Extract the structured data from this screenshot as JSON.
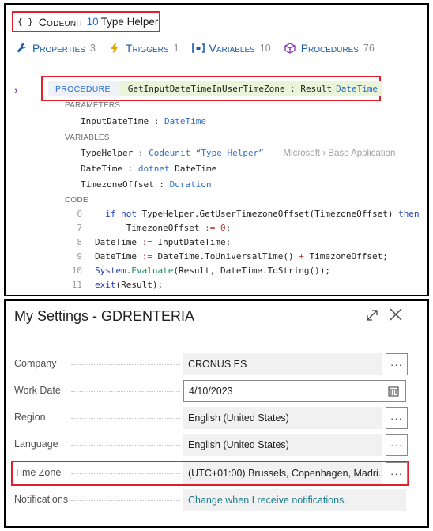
{
  "codeunit": {
    "kind": "Codeunit",
    "number": "10",
    "name": "Type Helper"
  },
  "tabs": [
    {
      "label": "Properties",
      "count": "3",
      "icon": "wrench-icon"
    },
    {
      "label": "Triggers",
      "count": "1",
      "icon": "lightning-icon"
    },
    {
      "label": "Variables",
      "count": "10",
      "icon": "variable-icon"
    },
    {
      "label": "Procedures",
      "count": "76",
      "icon": "cube-icon"
    }
  ],
  "procedure": {
    "tag": "PROCEDURE",
    "signature": "GetInputDateTimeInUserTimeZone : Result",
    "return_type": "DateTime"
  },
  "sections": {
    "parameters": "PARAMETERS",
    "variables": "VARIABLES",
    "code": "CODE"
  },
  "parameters": [
    {
      "name": "InputDateTime :",
      "type": "DateTime"
    }
  ],
  "variables": [
    {
      "name": "TypeHelper :",
      "type": "Codeunit “Type Helper”",
      "source": "Microsoft  ›  Base Application"
    },
    {
      "name": "DateTime :",
      "type": "dotnet",
      "type2": "DateTime"
    },
    {
      "name": "TimezoneOffset :",
      "type": "Duration"
    }
  ],
  "code_lines": [
    {
      "n": "6"
    },
    {
      "n": "7"
    },
    {
      "n": "8"
    },
    {
      "n": "9"
    },
    {
      "n": "10"
    },
    {
      "n": "11"
    }
  ],
  "settings": {
    "title": "My Settings - GDRENTERIA",
    "company_label": "Company",
    "company_value": "CRONUS ES",
    "workdate_label": "Work Date",
    "workdate_value": "4/10/2023",
    "region_label": "Region",
    "region_value": "English (United States)",
    "language_label": "Language",
    "language_value": "English (United States)",
    "timezone_label": "Time Zone",
    "timezone_value": "(UTC+01:00) Brussels, Copenhagen, Madri...",
    "notifications_label": "Notifications",
    "notifications_value": "Change when I receive notifications.",
    "more_label": "···"
  },
  "colors": {
    "highlight": "#e0202a",
    "link": "#1a5ca8",
    "teal_link": "#1a7d8a"
  }
}
